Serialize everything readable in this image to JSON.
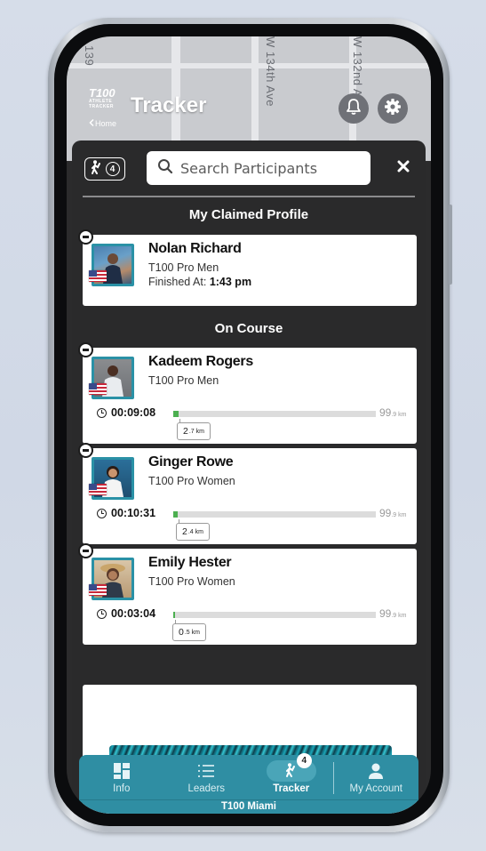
{
  "header": {
    "logo_text": "T100",
    "logo_sub": "ATHLETE TRACKER",
    "home_label": "Home",
    "title": "Tracker",
    "map_streets": [
      "139",
      "W 134th Ave",
      "W 132nd Ave"
    ]
  },
  "toolbar": {
    "participant_count": "4",
    "search_placeholder": "Search Participants",
    "search_value": ""
  },
  "claimed": {
    "section_title": "My Claimed Profile",
    "participant": {
      "name": "Nolan Richard",
      "category": "T100 Pro Men",
      "finished_label": "Finished At:",
      "finished_time": "1:43 pm"
    }
  },
  "on_course": {
    "section_title": "On Course",
    "course_total_value": "99",
    "course_total_decimal": ".9 km",
    "participants": [
      {
        "name": "Kadeem Rogers",
        "category": "T100 Pro Men",
        "elapsed": "00:09:08",
        "distance_value": "2",
        "distance_decimal": ".7 km",
        "progress": 0.027
      },
      {
        "name": "Ginger Rowe",
        "category": "T100 Pro Women",
        "elapsed": "00:10:31",
        "distance_value": "2",
        "distance_decimal": ".4 km",
        "progress": 0.024
      },
      {
        "name": "Emily Hester",
        "category": "T100 Pro Women",
        "elapsed": "00:03:04",
        "distance_value": "0",
        "distance_decimal": ".5 km",
        "progress": 0.005
      }
    ]
  },
  "bottom_nav": {
    "items": [
      {
        "label": "Info",
        "icon": "dashboard-icon"
      },
      {
        "label": "Leaders",
        "icon": "list-icon"
      },
      {
        "label": "Tracker",
        "icon": "walker-icon",
        "badge": "4"
      },
      {
        "label": "My Account",
        "icon": "person-icon"
      }
    ],
    "event_name": "T100 Miami"
  },
  "colors": {
    "accent": "#2f8ea3",
    "progress_fill": "#4caf50",
    "sheet_bg": "#2a2a2b"
  }
}
